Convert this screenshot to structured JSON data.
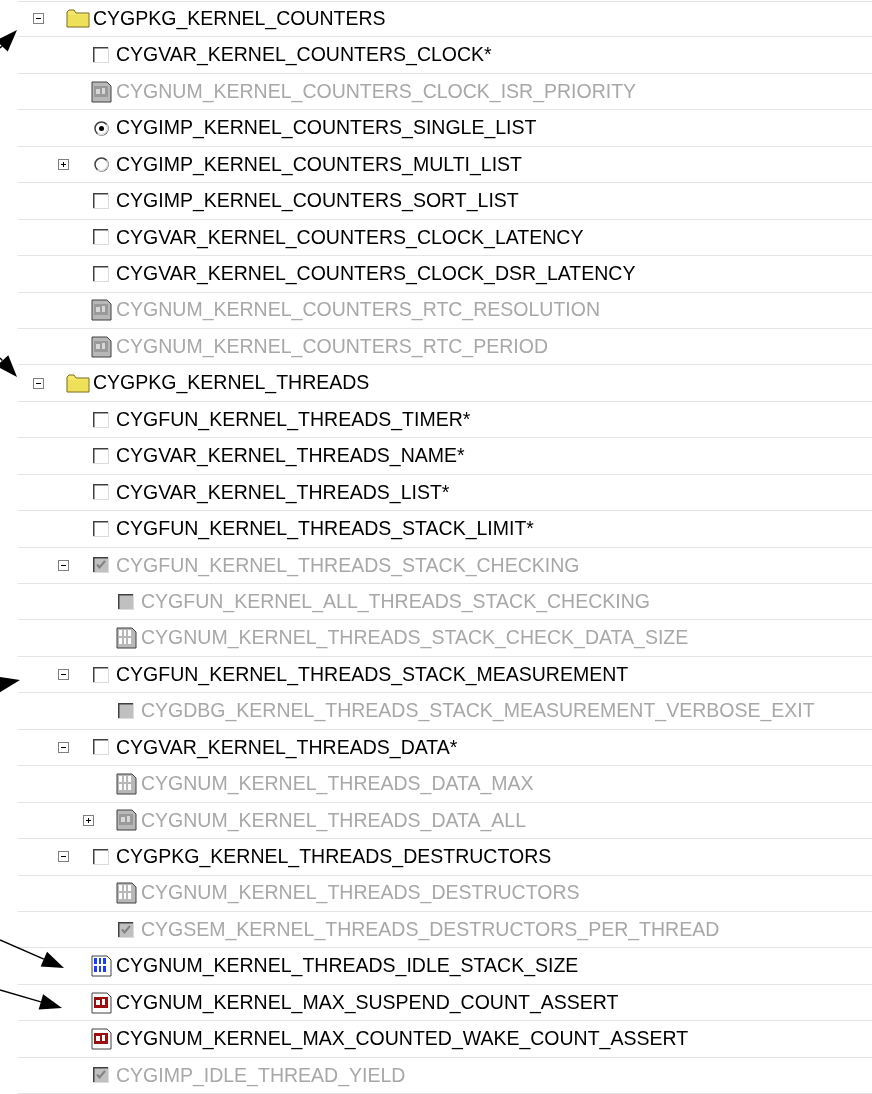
{
  "tree": [
    {
      "kind": "folder",
      "label": "CYGPKG_KERNEL_COUNTERS",
      "disabled": false,
      "expanded": true,
      "children": [
        {
          "kind": "checkbox",
          "label": "CYGVAR_KERNEL_COUNTERS_CLOCK*",
          "checked": false,
          "disabled": false
        },
        {
          "kind": "string",
          "label": "CYGNUM_KERNEL_COUNTERS_CLOCK_ISR_PRIORITY",
          "disabled": true
        },
        {
          "kind": "radio",
          "label": "CYGIMP_KERNEL_COUNTERS_SINGLE_LIST",
          "selected": true,
          "disabled": false
        },
        {
          "kind": "radio",
          "label": "CYGIMP_KERNEL_COUNTERS_MULTI_LIST",
          "selected": false,
          "disabled": false,
          "expanded": false
        },
        {
          "kind": "checkbox",
          "label": "CYGIMP_KERNEL_COUNTERS_SORT_LIST",
          "checked": false,
          "disabled": false
        },
        {
          "kind": "checkbox",
          "label": "CYGVAR_KERNEL_COUNTERS_CLOCK_LATENCY",
          "checked": false,
          "disabled": false
        },
        {
          "kind": "checkbox",
          "label": "CYGVAR_KERNEL_COUNTERS_CLOCK_DSR_LATENCY",
          "checked": false,
          "disabled": false
        },
        {
          "kind": "string",
          "label": "CYGNUM_KERNEL_COUNTERS_RTC_RESOLUTION",
          "disabled": true
        },
        {
          "kind": "string",
          "label": "CYGNUM_KERNEL_COUNTERS_RTC_PERIOD",
          "disabled": true
        }
      ]
    },
    {
      "kind": "folder",
      "label": "CYGPKG_KERNEL_THREADS",
      "disabled": false,
      "expanded": true,
      "children": [
        {
          "kind": "checkbox",
          "label": "CYGFUN_KERNEL_THREADS_TIMER*",
          "checked": false,
          "disabled": false
        },
        {
          "kind": "checkbox",
          "label": "CYGVAR_KERNEL_THREADS_NAME*",
          "checked": false,
          "disabled": false
        },
        {
          "kind": "checkbox",
          "label": "CYGVAR_KERNEL_THREADS_LIST*",
          "checked": false,
          "disabled": false
        },
        {
          "kind": "checkbox",
          "label": "CYGFUN_KERNEL_THREADS_STACK_LIMIT*",
          "checked": false,
          "disabled": false
        },
        {
          "kind": "checkbox",
          "label": "CYGFUN_KERNEL_THREADS_STACK_CHECKING",
          "checked": true,
          "disabled": true,
          "expanded": true,
          "children": [
            {
              "kind": "checkbox",
              "label": "CYGFUN_KERNEL_ALL_THREADS_STACK_CHECKING",
              "checked": false,
              "disabled": true
            },
            {
              "kind": "number",
              "label": "CYGNUM_KERNEL_THREADS_STACK_CHECK_DATA_SIZE",
              "disabled": true
            }
          ]
        },
        {
          "kind": "checkbox",
          "label": "CYGFUN_KERNEL_THREADS_STACK_MEASUREMENT",
          "checked": false,
          "disabled": false,
          "expanded": true,
          "children": [
            {
              "kind": "checkbox",
              "label": "CYGDBG_KERNEL_THREADS_STACK_MEASUREMENT_VERBOSE_EXIT",
              "checked": false,
              "disabled": true
            }
          ]
        },
        {
          "kind": "checkbox",
          "label": "CYGVAR_KERNEL_THREADS_DATA*",
          "checked": false,
          "disabled": false,
          "expanded": true,
          "children": [
            {
              "kind": "number",
              "label": "CYGNUM_KERNEL_THREADS_DATA_MAX",
              "disabled": true
            },
            {
              "kind": "string",
              "label": "CYGNUM_KERNEL_THREADS_DATA_ALL",
              "disabled": true,
              "expanded": false
            }
          ]
        },
        {
          "kind": "checkbox",
          "label": "CYGPKG_KERNEL_THREADS_DESTRUCTORS",
          "checked": false,
          "disabled": false,
          "expanded": true,
          "children": [
            {
              "kind": "number",
              "label": "CYGNUM_KERNEL_THREADS_DESTRUCTORS",
              "disabled": true
            },
            {
              "kind": "checkbox",
              "label": "CYGSEM_KERNEL_THREADS_DESTRUCTORS_PER_THREAD",
              "checked": true,
              "disabled": true
            }
          ]
        },
        {
          "kind": "number",
          "label": "CYGNUM_KERNEL_THREADS_IDLE_STACK_SIZE",
          "disabled": false
        },
        {
          "kind": "string",
          "label": "CYGNUM_KERNEL_MAX_SUSPEND_COUNT_ASSERT",
          "disabled": false
        },
        {
          "kind": "string",
          "label": "CYGNUM_KERNEL_MAX_COUNTED_WAKE_COUNT_ASSERT",
          "disabled": false
        },
        {
          "kind": "checkbox",
          "label": "CYGIMP_IDLE_THREAD_YIELD",
          "checked": true,
          "disabled": true
        }
      ]
    }
  ]
}
